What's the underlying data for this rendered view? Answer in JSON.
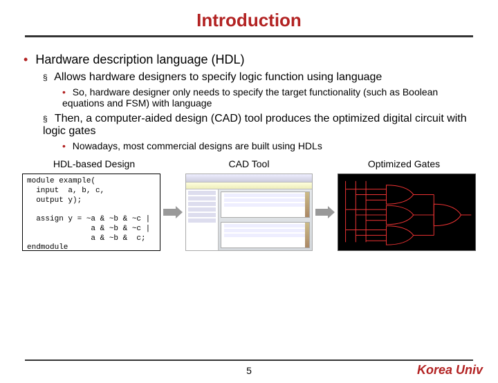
{
  "title": "Introduction",
  "bullets": {
    "l1": "Hardware description language (HDL)",
    "l2a": "Allows hardware designers to specify logic function using language",
    "l3a": "So, hardware designer only needs to specify the target functionality (such as Boolean equations and FSM) with language",
    "l2b": "Then, a computer-aided design (CAD) tool produces the optimized digital circuit with logic gates",
    "l3b": "Nowadays, most commercial designs are built using HDLs"
  },
  "labels": {
    "hdl": "HDL-based Design",
    "cad": "CAD Tool",
    "gates": "Optimized Gates"
  },
  "code": "module example(\n  input  a, b, c,\n  output y);\n\n  assign y = ~a & ~b & ~c |\n              a & ~b & ~c |\n              a & ~b &  c;\nendmodule",
  "page": "5",
  "brand": "Korea Univ"
}
